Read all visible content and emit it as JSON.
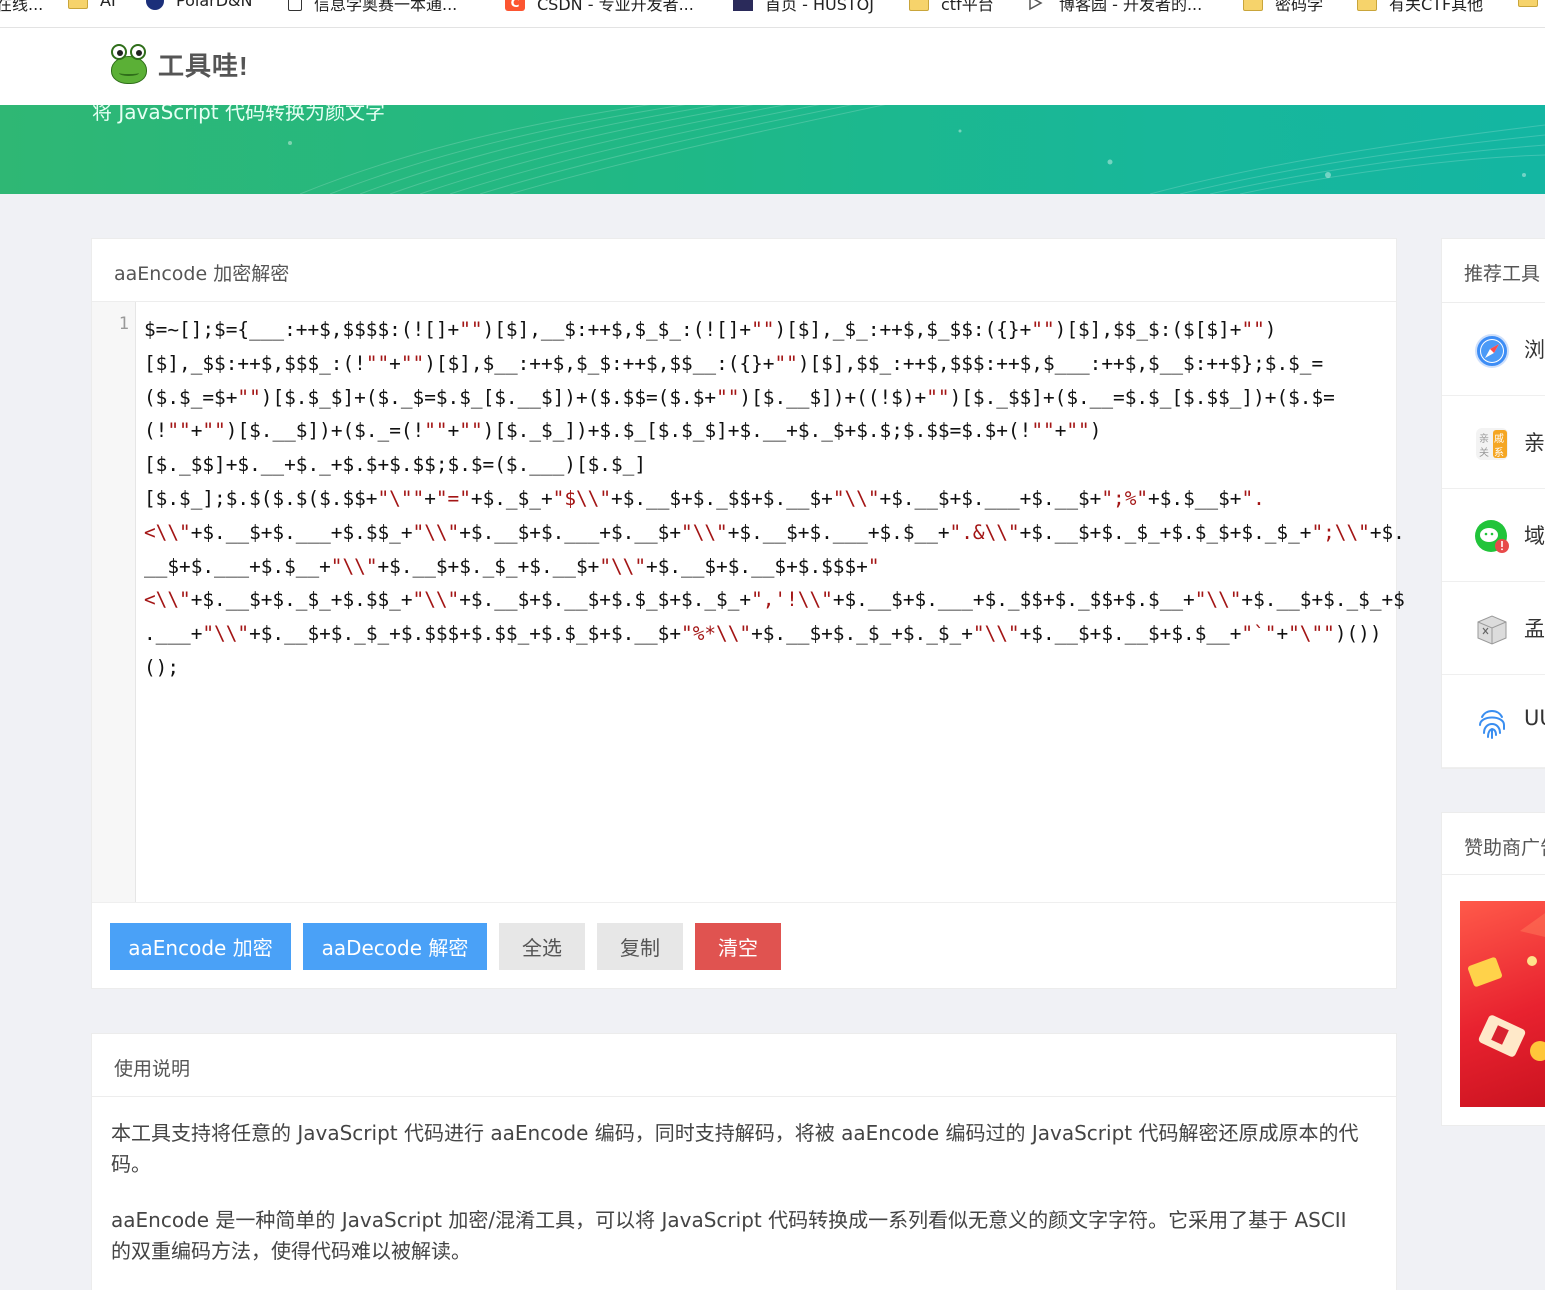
{
  "bookmarks": [
    {
      "label": "在线...",
      "icon": "folder-icon"
    },
    {
      "label": "AI",
      "icon": "folder-icon"
    },
    {
      "label": "PolarD&N",
      "icon": "polar-icon"
    },
    {
      "label": "信息学奥赛一本通...",
      "icon": "document-icon"
    },
    {
      "label": "CSDN - 专业开发者...",
      "icon": "csdn-icon"
    },
    {
      "label": "首页 - HUSTOJ",
      "icon": "hustoj-icon"
    },
    {
      "label": "ctf平台",
      "icon": "folder-icon"
    },
    {
      "label": "博客园 - 开发者的...",
      "icon": "cnblogs-icon"
    },
    {
      "label": "密码学",
      "icon": "folder-icon"
    },
    {
      "label": "有关CTF其他",
      "icon": "folder-icon"
    }
  ],
  "site": {
    "logo_text": "工具哇!",
    "banner_subtitle": "将 JavaScript 代码转换为颜文字"
  },
  "tool": {
    "title": "aaEncode 加密解密",
    "line_number": "1",
    "code_lines": [
      "$=~[];$={___:++$,$$$$:(![]+\"\")[$],__$:++$,$_$_:(![]+\"\")[$],_$_:++$,$_$$:({}+\"\")[$],$$_$:($[$]+\"\")",
      "[$],_$$:++$,$$$_:(!\"\"+\"\")[$],$__:++$,$_$:++$,$$__:({}+\"\")[$],$$_:++$,$$$:++$,$___:++$,$__$:++$};$.$_=",
      "($.$_=$+\"\")[$.$_$]+($._$=$.$_[$.__$])+($.$$=($.$+\"\")[$.__$])+((!$)+\"\")[$._$$]+($.__=$.$_[$.$$_])+($.$=",
      "(!\"\"+\"\")[$.__$])+($._=(!\"\"+\"\")[$._$_])+$.$_[$.$_$]+$.__+$._$+$.$;$.$$=$.$+(!\"\"+\"\")",
      "[$._$$]+$.__+$._+$.$+$.$$;$.$=($.___)[$.$_]",
      "[$.$_];$.$($.$($.$$+\"\\\"\"+\"=\"+$._$_+\"$\\\\\"+$.__$+$._$$+$.__$+\"\\\\\"+$.__$+$.___+$.__$+\";%\"+$.$__$+\".",
      "<\\\\\"+$.__$+$.___+$.$$_+\"\\\\\"+$.__$+$.___+$.__$+\"\\\\\"+$.__$+$.___+$.$__+\".&\\\\\"+$.__$+$._$_+$.$_$+$._$_+\";\\\\\"+$.",
      "__$+$.___+$.$__+\"\\\\\"+$.__$+$._$_+$.__$+\"\\\\\"+$.__$+$.__$+$.$$$+\"",
      "<\\\\\"+$.__$+$._$_+$.$$_+\"\\\\\"+$.__$+$.__$+$.$_$+$._$_+\",'!\\\\\"+$.__$+$.___+$._$$+$._$$+$.$__+\"\\\\\"+$.__$+$._$_+$",
      ".___+\"\\\\\"+$.__$+$._$_+$.$$$+$.$$_+$.$_$+$.__$+\"%*\\\\\"+$.__$+$._$_+$._$_+\"\\\\\"+$.__$+$.__$+$.$__+\"`\"+\"\\\"\")())",
      "();"
    ],
    "buttons": {
      "encode": "aaEncode 加密",
      "decode": "aaDecode 解密",
      "select_all": "全选",
      "copy": "复制",
      "clear": "清空"
    }
  },
  "usage": {
    "title": "使用说明",
    "paragraphs": [
      "本工具支持将任意的 JavaScript 代码进行 aaEncode 编码，同时支持解码，将被 aaEncode 编码过的 JavaScript 代码解密还原成原本的代码。",
      "aaEncode 是一种简单的 JavaScript 加密/混淆工具，可以将 JavaScript 代码转换成一系列看似无意义的颜文字字符。它采用了基于 ASCII 的双重编码方法，使得代码难以被解读。"
    ]
  },
  "sidebar": {
    "recommend_title": "推荐工具",
    "items": [
      {
        "label": "浏",
        "icon": "compass-icon"
      },
      {
        "label": "亲",
        "icon": "relation-icon"
      },
      {
        "label": "域",
        "icon": "wechat-icon"
      },
      {
        "label": "孟",
        "icon": "cube-icon"
      },
      {
        "label": "UU",
        "icon": "fingerprint-icon"
      }
    ],
    "sponsor_title": "赞助商广告"
  },
  "colors": {
    "primary_button": "#4aa1f7",
    "danger_button": "#e05350",
    "banner_green": "#1fb887"
  }
}
